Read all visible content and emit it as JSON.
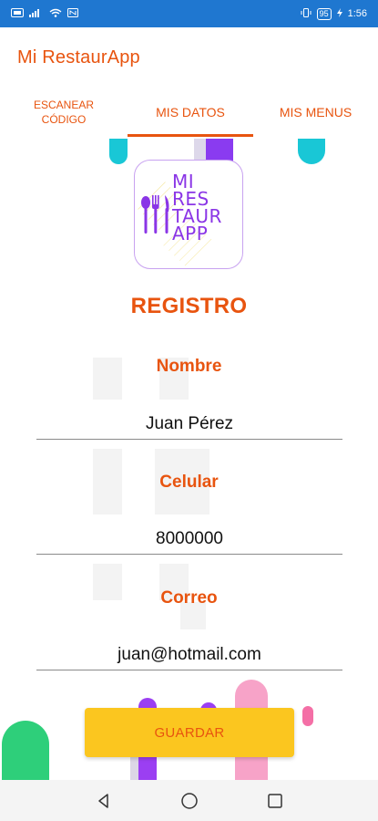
{
  "status_bar": {
    "time": "1:56",
    "battery": "95",
    "color": "#1f77d0"
  },
  "app": {
    "title": "Mi RestaurApp",
    "accent_color": "#e8540f"
  },
  "tabs": [
    {
      "label_line1": "ESCANEAR",
      "label_line2": "CÓDIGO",
      "selected": false
    },
    {
      "label": "MIS DATOS",
      "selected": true
    },
    {
      "label": "MIS MENUS",
      "selected": false
    }
  ],
  "logo": {
    "lines": [
      "MI",
      "RES",
      "TAUR",
      "APP"
    ],
    "icon": "cutlery-icon",
    "color": "#8a35e6"
  },
  "form": {
    "title": "REGISTRO",
    "fields": [
      {
        "label": "Nombre",
        "value": "Juan Pérez"
      },
      {
        "label": "Celular",
        "value": "8000000"
      },
      {
        "label": "Correo",
        "value": "juan@hotmail.com"
      }
    ],
    "save_label": "GUARDAR",
    "save_color": "#fbc61f"
  },
  "nav": {
    "icons": [
      "back-icon",
      "home-icon",
      "recents-icon"
    ]
  }
}
